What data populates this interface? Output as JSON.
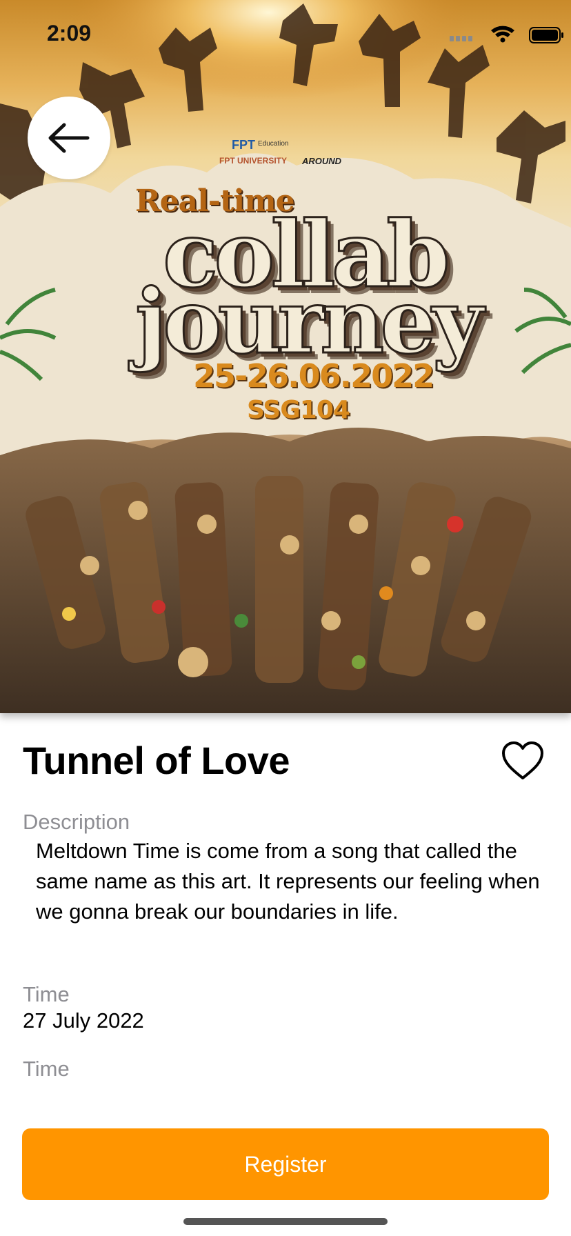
{
  "status_bar": {
    "time": "2:09"
  },
  "poster": {
    "brand_fpt": "FPT",
    "brand_education": "Education",
    "brand_university": "FPT UNIVERSITY",
    "brand_around": "AROUND",
    "tagline": "Real-time",
    "title_line1": "collab",
    "title_line2": "journey",
    "date": "25-26.06.2022",
    "room": "SSG104"
  },
  "event": {
    "title": "Tunnel of Love",
    "description_label": "Description",
    "description": "Meltdown Time is come from a song that called the same name as this art. It represents our feeling when we gonna break our boundaries in life.",
    "time_label": "Time",
    "time_value": "27 July 2022",
    "time_label_2": "Time"
  },
  "actions": {
    "register_label": "Register"
  },
  "colors": {
    "accent": "#ff9500",
    "secondary_text": "#8e8e93"
  },
  "icons": {
    "back": "arrow-left-icon",
    "favorite": "heart-outline-icon"
  }
}
